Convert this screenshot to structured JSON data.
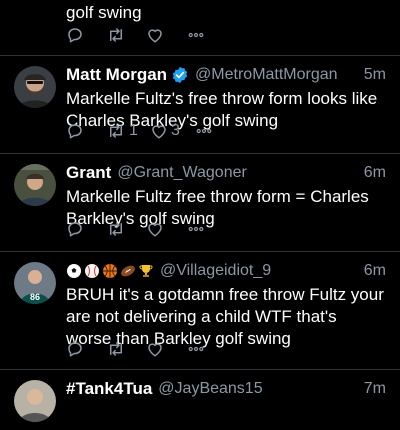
{
  "tweets": [
    {
      "text": "golf swing",
      "reply_icon": "reply-icon",
      "retweet_icon": "retweet-icon",
      "like_icon": "like-icon",
      "more_icon": "more-icon"
    },
    {
      "name": "Matt Morgan",
      "verified": true,
      "handle": "@MetroMattMorgan",
      "time": "5m",
      "text": "Markelle Fultz's free throw form looks like Charles Barkley's golf swing",
      "retweets": "1",
      "likes": "3"
    },
    {
      "name": "Grant",
      "handle": "@Grant_Wagoner",
      "time": "6m",
      "text": "Markelle Fultz free throw form = Charles Barkley's golf swing"
    },
    {
      "name_emojis": [
        "soccer-ball",
        "baseball",
        "basketball",
        "football",
        "trophy"
      ],
      "handle": "@Villageidiot_9",
      "time": "6m",
      "text": "BRUH it's a gotdamn  free throw Fultz your are not delivering a child WTF that's worse than Barkley golf swing"
    },
    {
      "name": "#Tank4Tua",
      "handle": "@JayBeans15",
      "time": "7m"
    }
  ],
  "colors": {
    "background": "#000000",
    "primary_text": "#ffffff",
    "secondary_text": "#8b98a5",
    "verified_blue": "#1da1f2",
    "divider": "#2f3336"
  }
}
